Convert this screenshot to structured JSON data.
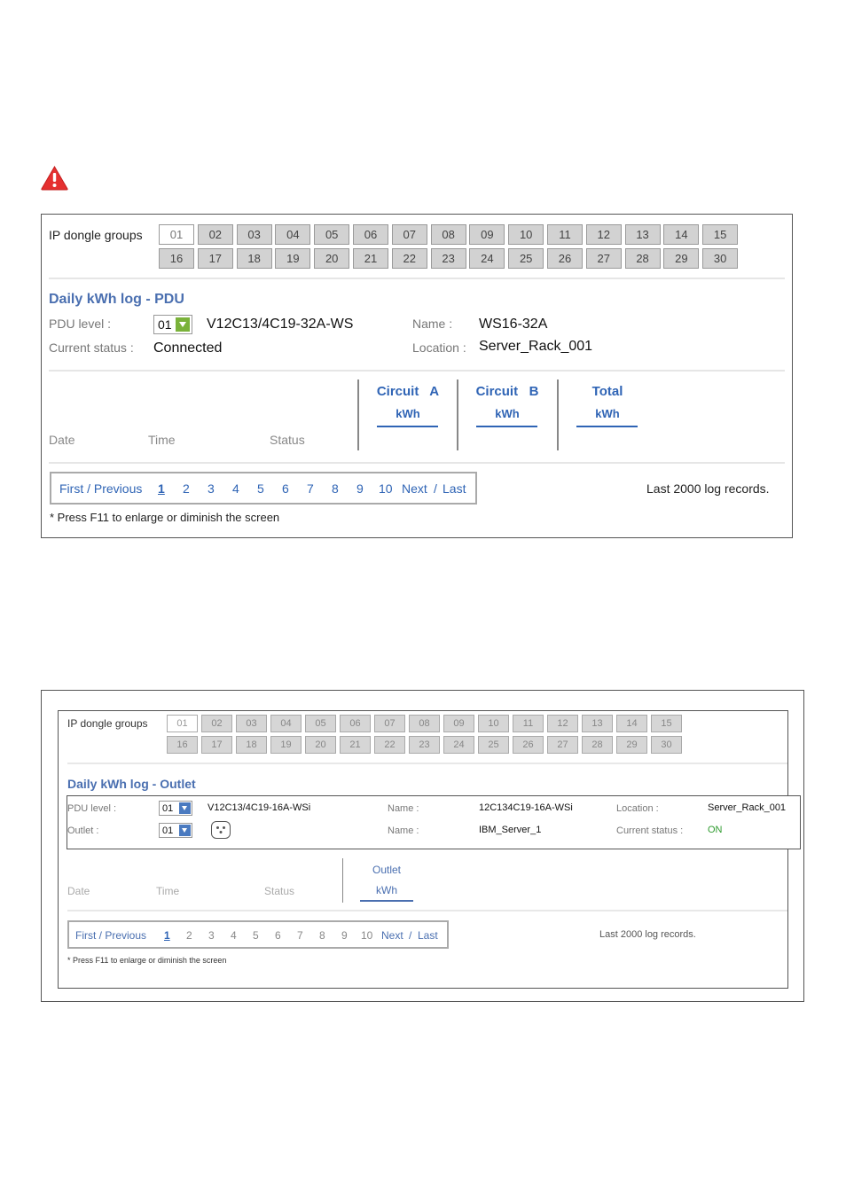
{
  "warning_icon": "warning-triangle-icon",
  "colors": {
    "link_blue": "#2f64b5",
    "title_blue": "#4a6fb0",
    "status_on": "#2e9b2e",
    "warning_red": "#e53030"
  },
  "panel1": {
    "groups_label": "IP dongle groups",
    "groups": [
      "01",
      "02",
      "03",
      "04",
      "05",
      "06",
      "07",
      "08",
      "09",
      "10",
      "11",
      "12",
      "13",
      "14",
      "15",
      "16",
      "17",
      "18",
      "19",
      "20",
      "21",
      "22",
      "23",
      "24",
      "25",
      "26",
      "27",
      "28",
      "29",
      "30"
    ],
    "active_group": "01",
    "title": "Daily kWh log - PDU",
    "pdu_level_label": "PDU level :",
    "pdu_level_value": "01",
    "model": "V12C13/4C19-32A-WS",
    "name_label": "Name :",
    "name_value": "WS16-32A",
    "status_label": "Current status :",
    "status_value": "Connected",
    "location_label": "Location :",
    "location_value": "Server_Rack_001",
    "columns": {
      "date": "Date",
      "time": "Time",
      "status": "Status",
      "circuit_a": "Circuit   A",
      "circuit_b": "Circuit   B",
      "total": "Total",
      "unit": "kWh"
    },
    "pager": {
      "first_prev": "First / Previous",
      "pages": [
        "1",
        "2",
        "3",
        "4",
        "5",
        "6",
        "7",
        "8",
        "9",
        "10"
      ],
      "current": "1",
      "next_last_next": "Next",
      "slash": "/",
      "last": "Last"
    },
    "records": "Last 2000 log records.",
    "note": "* Press F11 to enlarge or diminish the screen"
  },
  "panel2": {
    "groups_label": "IP dongle groups",
    "groups": [
      "01",
      "02",
      "03",
      "04",
      "05",
      "06",
      "07",
      "08",
      "09",
      "10",
      "11",
      "12",
      "13",
      "14",
      "15",
      "16",
      "17",
      "18",
      "19",
      "20",
      "21",
      "22",
      "23",
      "24",
      "25",
      "26",
      "27",
      "28",
      "29",
      "30"
    ],
    "title": "Daily kWh log - Outlet",
    "pdu_level_label": "PDU level :",
    "pdu_level_value": "01",
    "model": "V12C13/4C19-16A-WSi",
    "name_label": "Name :",
    "name_value": "12C134C19-16A-WSi",
    "location_label": "Location :",
    "location_value": "Server_Rack_001",
    "outlet_label": "Outlet :",
    "outlet_value": "01",
    "outlet_icon": "power-outlet-icon",
    "outlet_name_label": "Name :",
    "outlet_name_value": "IBM_Server_1",
    "status_label": "Current status :",
    "status_value": "ON",
    "columns": {
      "date": "Date",
      "time": "Time",
      "status": "Status",
      "outlet": "Outlet",
      "unit": "kWh"
    },
    "pager": {
      "first_prev": "First / Previous",
      "pages": [
        "1",
        "2",
        "3",
        "4",
        "5",
        "6",
        "7",
        "8",
        "9",
        "10"
      ],
      "next": "Next",
      "slash": "/",
      "last": "Last"
    },
    "records": "Last 2000 log records.",
    "note": "* Press F11 to enlarge or diminish the screen"
  }
}
